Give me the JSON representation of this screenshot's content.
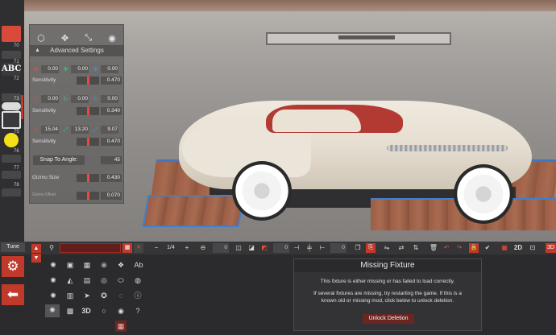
{
  "advanced_settings": {
    "title": "Advanced Settings",
    "position": {
      "x": "0.00",
      "y": "0.00",
      "z": "0.00",
      "sensitivity_label": "Sensitivity",
      "sensitivity": "0.470"
    },
    "rotation": {
      "x": "0.00",
      "y": "0.00",
      "z": "0.00",
      "sensitivity_label": "Sensitivity",
      "sensitivity": "0.340"
    },
    "scale": {
      "x": "15.04",
      "y": "13.20",
      "z": "9.07",
      "sensitivity_label": "Sensitivity",
      "sensitivity": "0.470"
    },
    "snap_label": "Snap To Angle:",
    "snap_value": "45",
    "gizmo_size_label": "Gizmo Size",
    "gizmo_size": "0.430",
    "gizmo_offset_label": "Gizmo Offset",
    "gizmo_offset": "0.070"
  },
  "left_strip": {
    "numbers": [
      "70",
      "71",
      "72",
      "73",
      "74",
      "75",
      "76",
      "77",
      "78"
    ],
    "abc_label": "ABC"
  },
  "toolbar": {
    "tune_label": "Tune",
    "page": "1/4",
    "value_a": "0",
    "value_b": "0",
    "value_c": "0",
    "d3_label": "3D",
    "d2_label": "2D",
    "d3_right_label": "3D"
  },
  "palette": {
    "ab_label": "Ab",
    "d3_label": "3D"
  },
  "dialog": {
    "title": "Missing Fixture",
    "line1": "This fixture is either missing or has failed to load correctly.",
    "line2": "If several fixtures are missing, try restarting the game. If this is a",
    "line3": "known old or missing mod, click below to unlock deletion.",
    "button": "Unlock Deletion"
  },
  "colors": {
    "accent": "#c0392b",
    "panel": "#2b2b2d",
    "dialog_bg": "#333335"
  }
}
